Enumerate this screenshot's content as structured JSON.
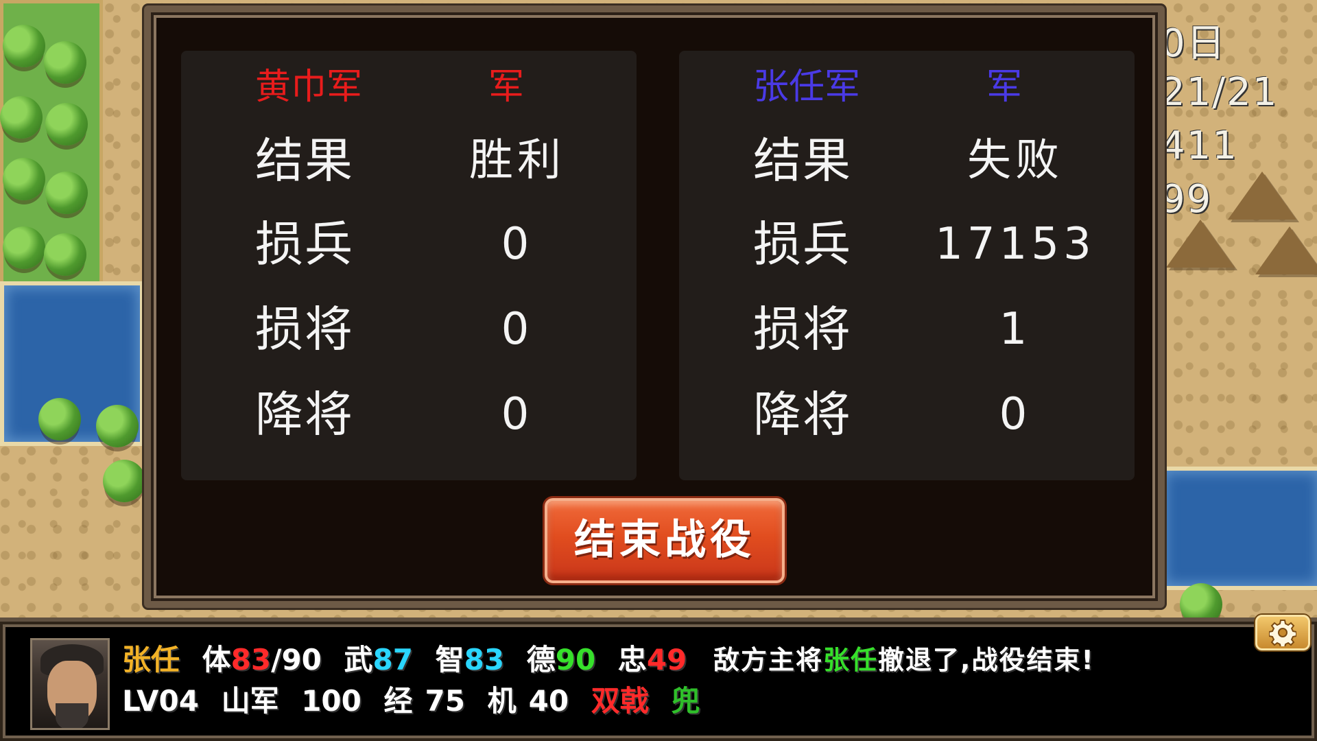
{
  "hud": {
    "line1": "0日",
    "line2": "21/21",
    "line3": "411",
    "line4": "99"
  },
  "left_side": {
    "army_name": "黄巾军",
    "army_tag": "军",
    "name_color": "#e81c1c",
    "rows": [
      {
        "label": "结果",
        "value": "胜利"
      },
      {
        "label": "损兵",
        "value": "0"
      },
      {
        "label": "损将",
        "value": "0"
      },
      {
        "label": "降将",
        "value": "0"
      }
    ]
  },
  "right_side": {
    "army_name": "张任军",
    "army_tag": "军",
    "name_color": "#4a3ae6",
    "rows": [
      {
        "label": "结果",
        "value": "失败"
      },
      {
        "label": "损兵",
        "value": "17153"
      },
      {
        "label": "损将",
        "value": "1"
      },
      {
        "label": "降将",
        "value": "0"
      }
    ]
  },
  "end_button": {
    "label": "结束战役"
  },
  "general": {
    "name": "张任",
    "hp_label": "体",
    "hp": "83",
    "hp_max": "/90",
    "str_label": "武",
    "str": "87",
    "int_label": "智",
    "int": "83",
    "virtue_label": "德",
    "virtue": "90",
    "loyalty_label": "忠",
    "loyalty": "49",
    "level": "LV04",
    "unit_type": "山军",
    "troops": "100",
    "exp_label": "经",
    "exp": "75",
    "move_label": "机",
    "move": "40",
    "weapon": "双戟",
    "armor": "兜"
  },
  "message": {
    "prefix": "敌方主将",
    "name": "张任",
    "suffix": "撤退了,战役结束!"
  },
  "colors": {
    "name_yellow": "#f2b227",
    "hp_red": "#ff2a2a",
    "str_cyan": "#2ad6ff",
    "virtue_green": "#36e02b",
    "weapon_red": "#ff2a2a",
    "armor_green": "#2fbf2a",
    "message_green": "#36e02b"
  },
  "icons": {
    "settings": "gear-icon"
  }
}
